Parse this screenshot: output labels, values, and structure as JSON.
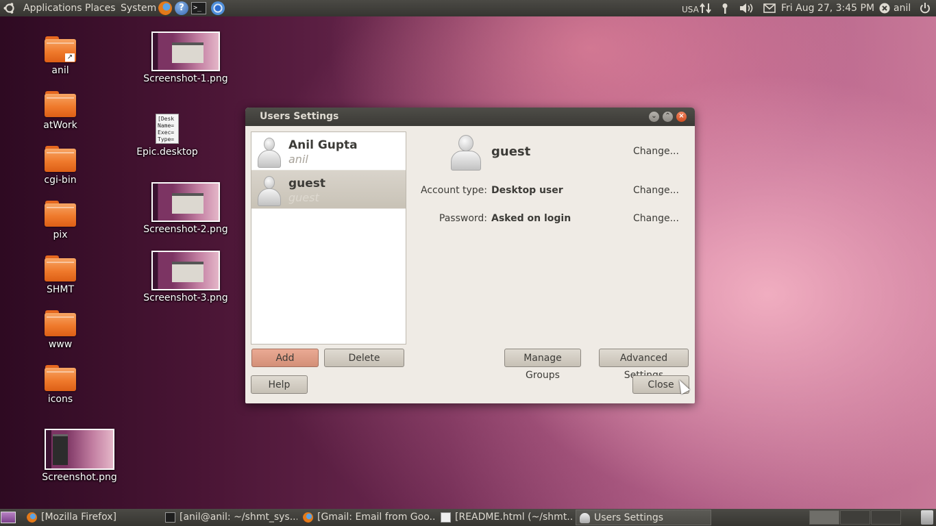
{
  "top_panel": {
    "menus": [
      "Applications",
      "Places",
      "System"
    ],
    "keyboard_layout": "USA",
    "clock": "Fri Aug 27,  3:45 PM",
    "user": "anil"
  },
  "desktop": {
    "folders": [
      "anil",
      "atWork",
      "cgi-bin",
      "pix",
      "SHMT",
      "www",
      "icons"
    ],
    "files": [
      "Screenshot-1.png",
      "Epic.desktop",
      "Screenshot-2.png",
      "Screenshot-3.png",
      "Screenshot.png"
    ],
    "desktop_file_preview": [
      "[Desk",
      "Name=",
      "Exec=",
      "Type="
    ]
  },
  "dialog": {
    "title": "Users Settings",
    "users": [
      {
        "name": "Anil Gupta",
        "login": "anil"
      },
      {
        "name": "guest",
        "login": "guest"
      }
    ],
    "selected_user": "guest",
    "account_type_label": "Account type:",
    "account_type_value": "Desktop user",
    "password_label": "Password:",
    "password_value": "Asked on login",
    "change_label": "Change...",
    "buttons": {
      "add": "Add",
      "delete": "Delete",
      "manage_groups": "Manage Groups",
      "advanced_settings": "Advanced Settings",
      "help": "Help",
      "close": "Close"
    }
  },
  "taskbar": {
    "tasks": [
      {
        "label": "[Mozilla Firefox]",
        "icon": "firefox-icon"
      },
      {
        "label": "[anil@anil: ~/shmt_sys...",
        "icon": "terminal-icon"
      },
      {
        "label": "[Gmail: Email from Goo...",
        "icon": "firefox-icon"
      },
      {
        "label": "[README.html (~/shmt...",
        "icon": "text-editor-icon"
      },
      {
        "label": "Users Settings",
        "icon": "users-icon"
      }
    ]
  },
  "colors": {
    "panel": "#3c3b37",
    "dialog_bg": "#efebe5",
    "accent": "#dd4814"
  }
}
